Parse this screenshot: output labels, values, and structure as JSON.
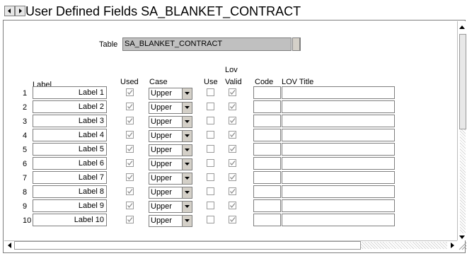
{
  "window": {
    "title": "User Defined Fields SA_BLANKET_CONTRACT"
  },
  "table": {
    "label": "Table",
    "value": "SA_BLANKET_CONTRACT"
  },
  "headers": {
    "label": "Label",
    "used": "Used",
    "case": "Case",
    "use": "Use",
    "lov_valid_top": "Lov",
    "lov_valid_bottom": "Valid",
    "code": "Code",
    "lov_title": "LOV Title"
  },
  "rows": [
    {
      "num": "1",
      "label": "Label 1",
      "used": true,
      "case": "Upper",
      "use": false,
      "lov_valid": true,
      "code": "",
      "lov_title": ""
    },
    {
      "num": "2",
      "label": "Label 2",
      "used": true,
      "case": "Upper",
      "use": false,
      "lov_valid": true,
      "code": "",
      "lov_title": ""
    },
    {
      "num": "3",
      "label": "Label 3",
      "used": true,
      "case": "Upper",
      "use": false,
      "lov_valid": true,
      "code": "",
      "lov_title": ""
    },
    {
      "num": "4",
      "label": "Label 4",
      "used": true,
      "case": "Upper",
      "use": false,
      "lov_valid": true,
      "code": "",
      "lov_title": ""
    },
    {
      "num": "5",
      "label": "Label 5",
      "used": true,
      "case": "Upper",
      "use": false,
      "lov_valid": true,
      "code": "",
      "lov_title": ""
    },
    {
      "num": "6",
      "label": "Label 6",
      "used": true,
      "case": "Upper",
      "use": false,
      "lov_valid": true,
      "code": "",
      "lov_title": ""
    },
    {
      "num": "7",
      "label": "Label 7",
      "used": true,
      "case": "Upper",
      "use": false,
      "lov_valid": true,
      "code": "",
      "lov_title": ""
    },
    {
      "num": "8",
      "label": "Label 8",
      "used": true,
      "case": "Upper",
      "use": false,
      "lov_valid": true,
      "code": "",
      "lov_title": ""
    },
    {
      "num": "9",
      "label": "Label 9",
      "used": true,
      "case": "Upper",
      "use": false,
      "lov_valid": true,
      "code": "",
      "lov_title": ""
    },
    {
      "num": "10",
      "label": "Label 10",
      "used": true,
      "case": "Upper",
      "use": false,
      "lov_valid": true,
      "code": "",
      "lov_title": ""
    }
  ],
  "icons": {
    "prev": "left-arrow-icon",
    "next": "right-arrow-icon",
    "dropdown": "chevron-down-icon",
    "checkmark": "checkmark-icon"
  }
}
